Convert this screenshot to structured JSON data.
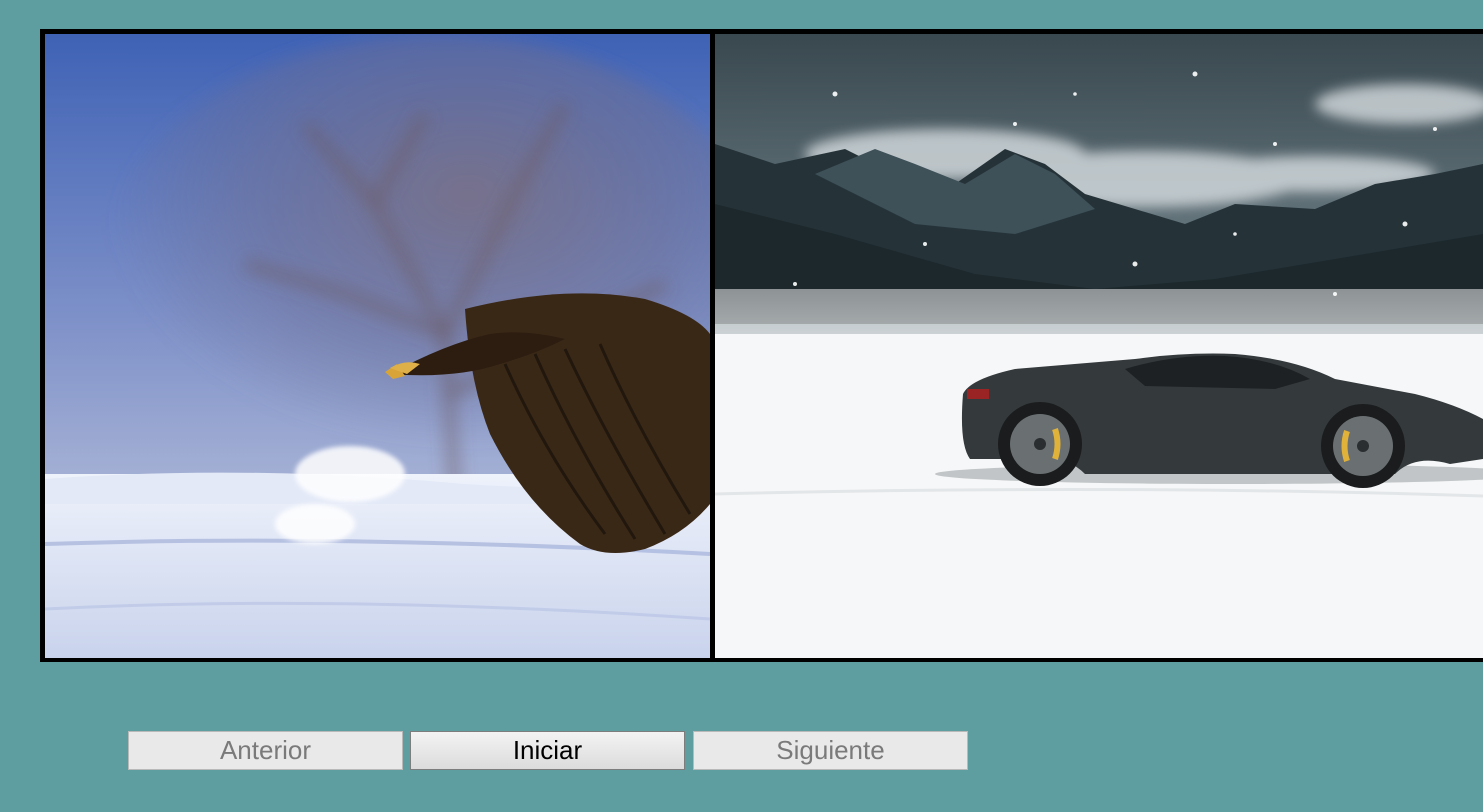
{
  "slideshow": {
    "slides": [
      {
        "subject": "eagle in snow"
      },
      {
        "subject": "sports car in snow"
      }
    ]
  },
  "controls": {
    "previous_label": "Anterior",
    "start_label": "Iniciar",
    "next_label": "Siguiente"
  },
  "colors": {
    "background": "#5f9ea0",
    "frame": "#000000"
  }
}
